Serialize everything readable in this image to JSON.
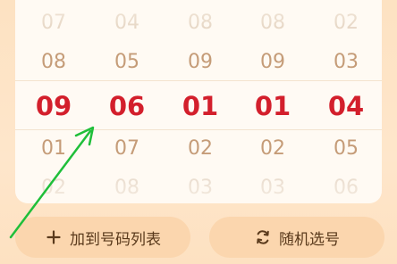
{
  "picker": {
    "columns": [
      {
        "rows": [
          "07",
          "08",
          "09",
          "01",
          "02"
        ]
      },
      {
        "rows": [
          "04",
          "05",
          "06",
          "07",
          "08"
        ]
      },
      {
        "rows": [
          "08",
          "09",
          "01",
          "02",
          "03"
        ]
      },
      {
        "rows": [
          "08",
          "09",
          "01",
          "02",
          "03"
        ]
      },
      {
        "rows": [
          "02",
          "03",
          "04",
          "05",
          "06"
        ]
      }
    ]
  },
  "buttons": {
    "add_label": "加到号码列表",
    "add_icon": "plus-icon",
    "random_label": "随机选号",
    "random_icon": "refresh-icon"
  },
  "colors": {
    "selected": "#d31f2c",
    "neighbor": "#c59c78",
    "button_bg": "#fbd6ae",
    "page_bg": "#fde3c4",
    "annotation_arrow": "#1fbf3a"
  }
}
